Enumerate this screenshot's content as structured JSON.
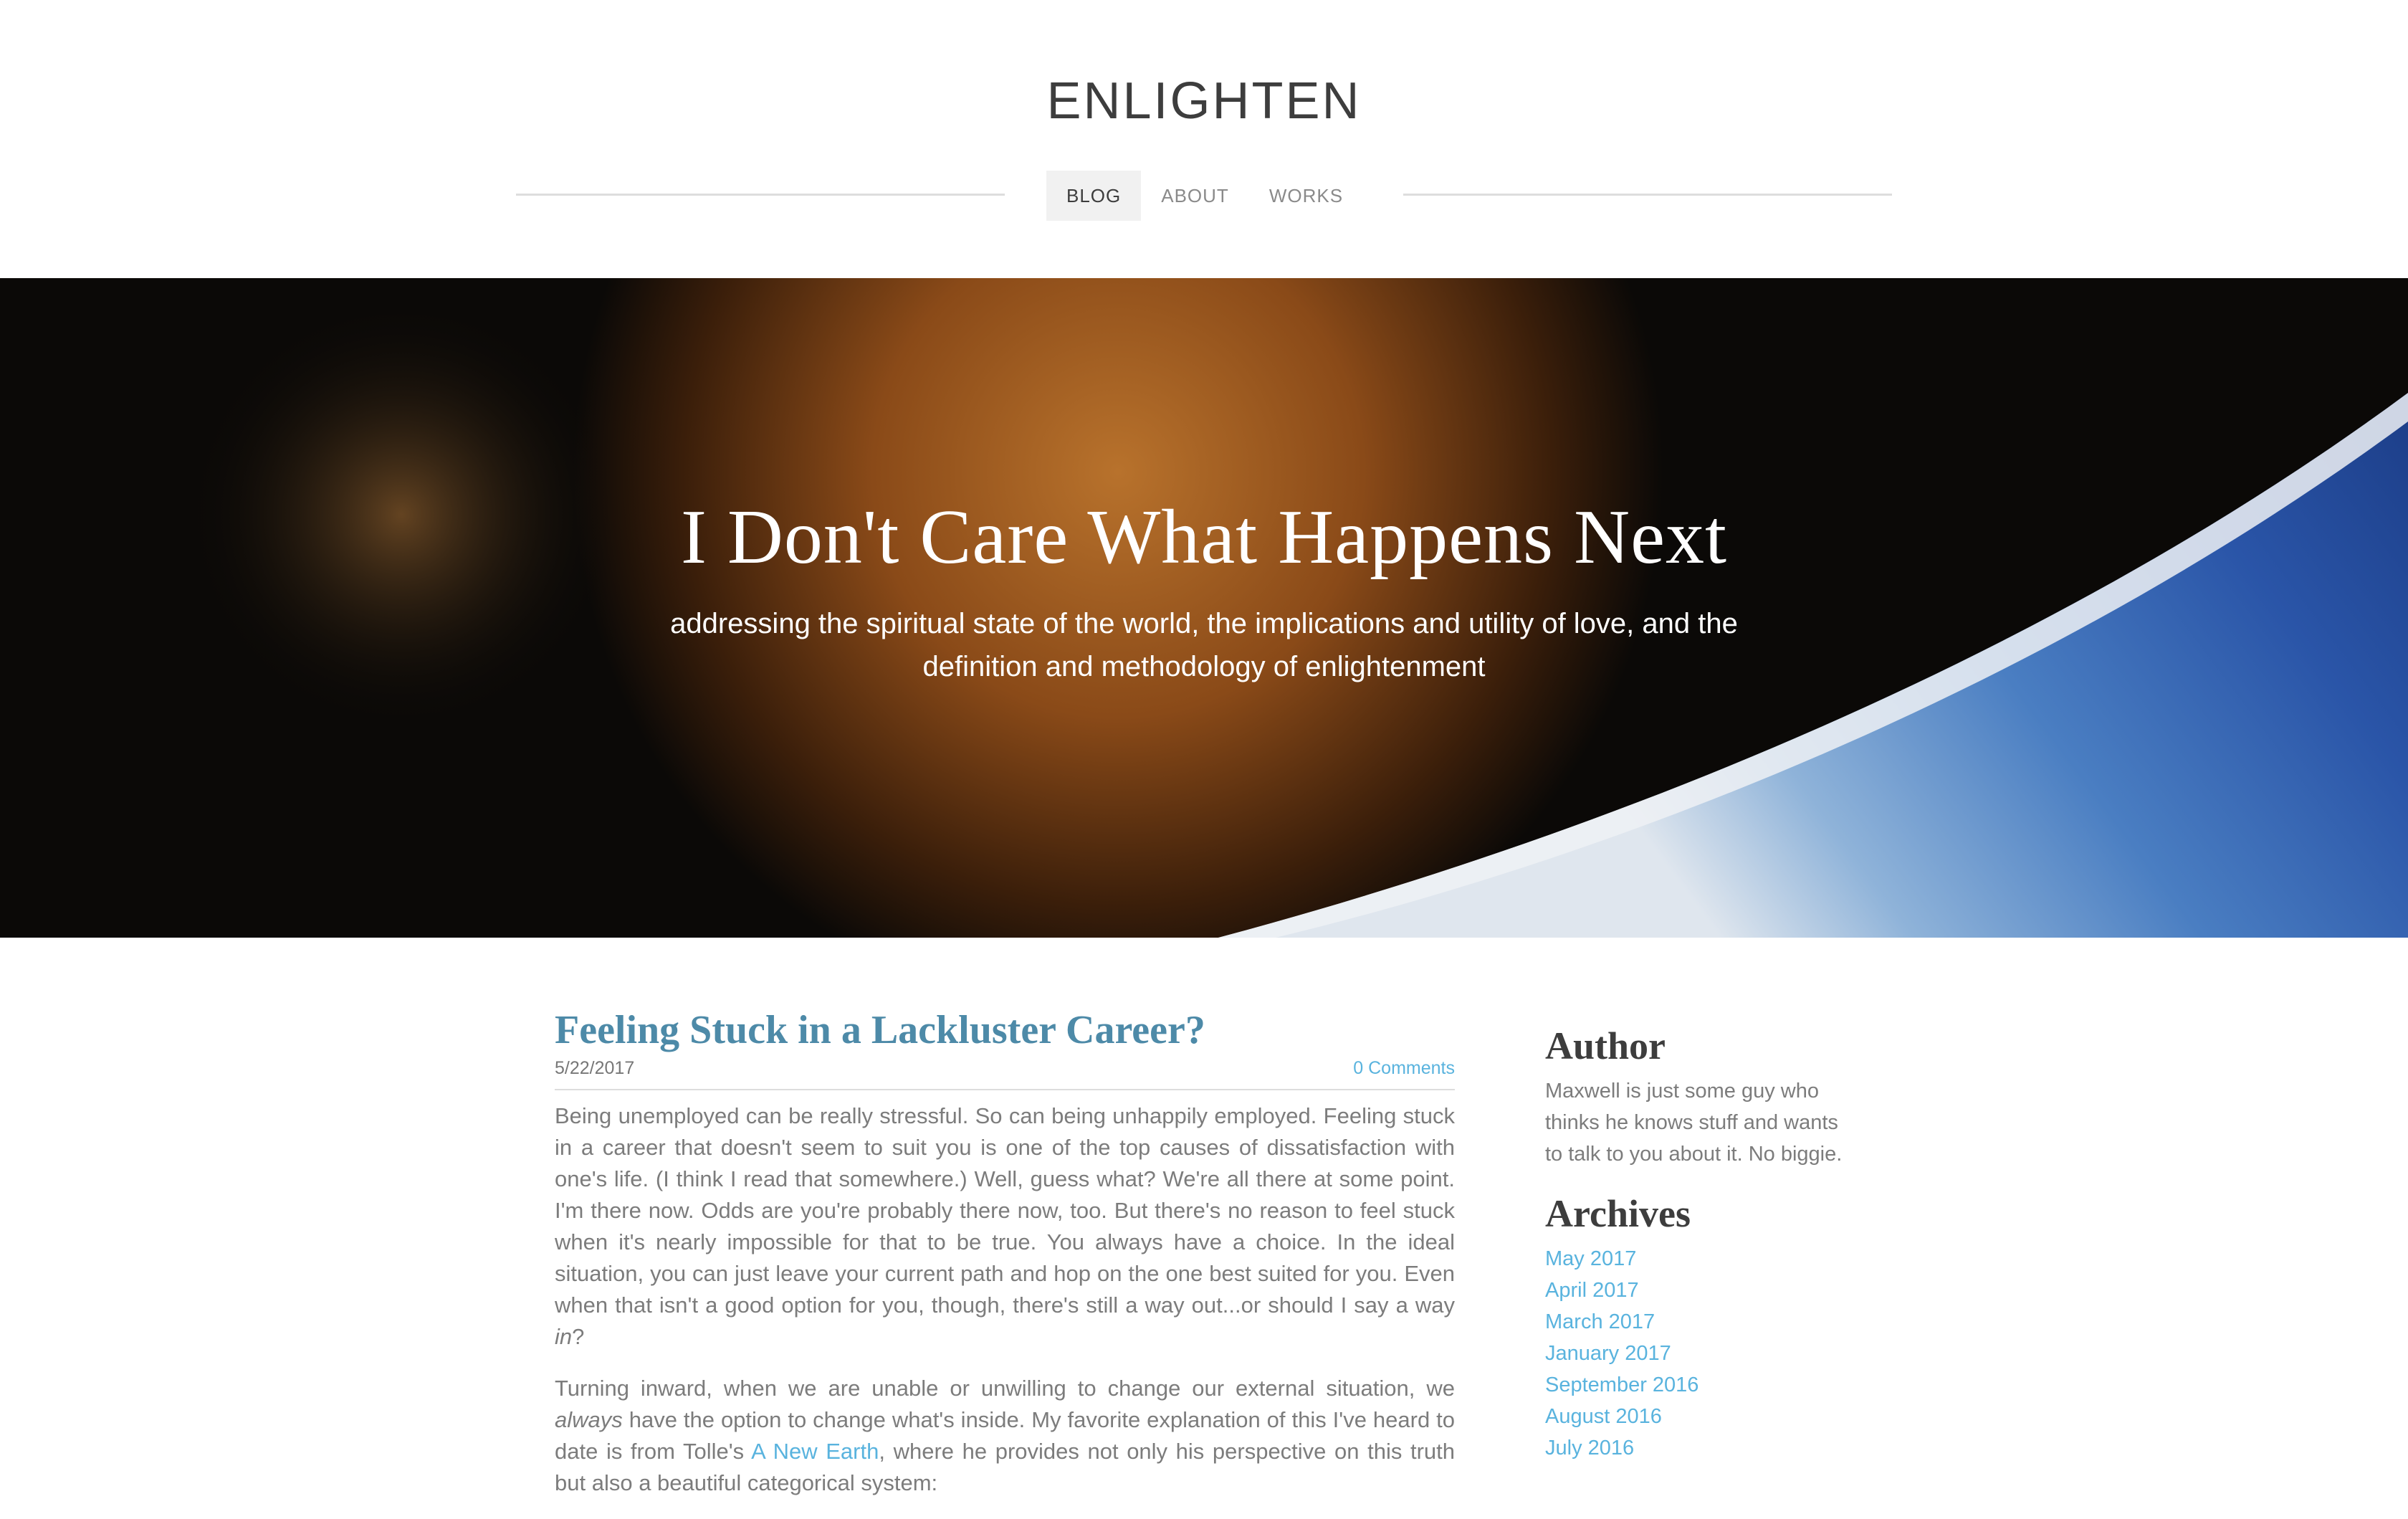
{
  "site": {
    "title": "ENLIGHTEN"
  },
  "nav": {
    "items": [
      "BLOG",
      "ABOUT",
      "WORKS"
    ],
    "active": "BLOG"
  },
  "hero": {
    "title": "I Don't Care What Happens Next",
    "subtitle": "addressing the spiritual state of the world, the implications and utility of love, and the definition and methodology of enlightenment"
  },
  "post": {
    "title": "Feeling Stuck in a Lackluster Career?",
    "date": "5/22/2017",
    "comments": "0 Comments",
    "p1": "Being unemployed can be really stressful. So can being unhappily employed. Feeling stuck in a career that doesn't seem to suit you is one of the top causes of dissatisfaction with one's life. (I think I read that somewhere.) Well, guess what? We're all there at some point. I'm there now. Odds are you're probably there now, too. But there's no reason to feel stuck when it's nearly impossible for that to be true. You always have a choice. In the ideal situation, you can just leave your current path and hop on the one best suited for you. Even when that isn't a good option for you, though, there's still a way out...or should I say a way ",
    "p1_em": "in",
    "p1_end": "?",
    "p2_a": "Turning inward, when we are unable or unwilling to change our external situation, we ",
    "p2_em": "always",
    "p2_b": " have the option to change what's inside. My favorite explanation of this I've heard to date is from Tolle's ",
    "p2_link": "A New Earth",
    "p2_c": ", where he provides not only his perspective on this truth but also a beautiful categorical system:"
  },
  "sidebar": {
    "author_heading": "Author",
    "author_text": "Maxwell is just some guy who thinks he knows stuff and wants to talk to you about it. No biggie.",
    "archives_heading": "Archives",
    "archives": [
      "May 2017",
      "April 2017",
      "March 2017",
      "January 2017",
      "September 2016",
      "August 2016",
      "July 2016"
    ]
  },
  "colors": {
    "link": "#59b3de",
    "post_title": "#4d8aa8",
    "nav_active_bg": "#f1f1f1"
  }
}
